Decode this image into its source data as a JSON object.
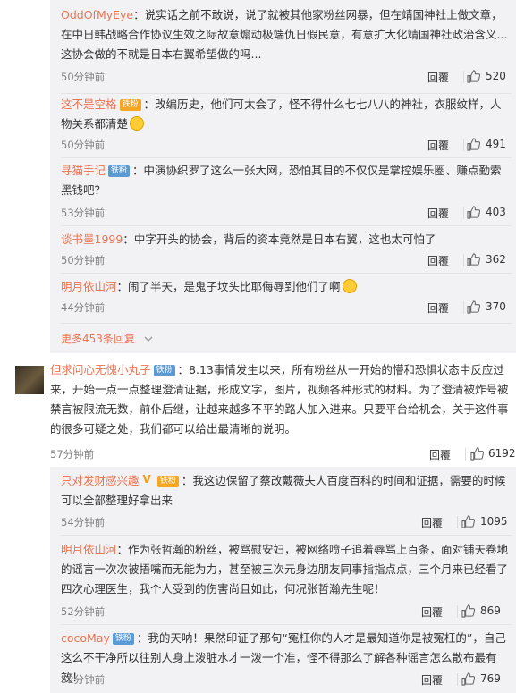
{
  "reply_label": "回覆",
  "thread1": {
    "replies": [
      {
        "user": "OddOfMyEye",
        "badge": null,
        "emoji": false,
        "text": "说实话之前不敢说，说了就被其他家粉丝网暴，但在靖国神社上做文章，在中日韩战略合作协议生效之际故意煽动极端仇日假民意，有意扩大化靖国神社政治含义...这协会做的不就是日本右翼希望做的吗...",
        "time": "50分钟前",
        "likes": "520"
      },
      {
        "user": "这不是空格",
        "badge": "铁粉",
        "emoji": true,
        "text": "改编历史，他们可太会了，怪不得什么七七八八的神社，衣服纹样，人物关系都清楚",
        "time": "50分钟前",
        "likes": "491"
      },
      {
        "user": "寻猫手记",
        "badge": "铁粉",
        "emoji": false,
        "text": "中演协织罗了这么一张大网，恐怕其目的不仅仅是掌控娱乐圈、赚点勤索黑钱吧？",
        "time": "53分钟前",
        "likes": "403"
      },
      {
        "user": "谈书墨1999",
        "badge": null,
        "emoji": false,
        "text": "中字开头的协会，背后的资本竟然是日本右翼，这也太可怕了",
        "time": "50分钟前",
        "likes": "362"
      },
      {
        "user": "明月依山河",
        "badge": null,
        "emoji": true,
        "text": "闹了半天，是鬼子坟头比耶侮辱到他们了啊",
        "time": "44分钟前",
        "likes": "370"
      }
    ],
    "more_label": "更多453条回复"
  },
  "main_comment": {
    "user": "但求问心无愧小丸子",
    "badge": "铁粉",
    "text": "8.13事情发生以来，所有粉丝从一开始的懵和恐惧状态中反应过来，开始一点一点整理澄清证据，形成文字，图片，视频各种形式的材料。为了澄清被炸号被禁言被限流无数，前仆后继，让越来越多不平的路人加入进来。只要平台给机会，关于这件事的很多可疑之处，我们都可以给出最清晰的说明。",
    "time": "57分钟前",
    "likes": "6192"
  },
  "thread2": {
    "replies": [
      {
        "user": "只对发财感兴趣",
        "badge": "铁粉",
        "vip": "V",
        "text": "我这边保留了蔡改戴薇夫人百度百科的时间和证据，需要的时候可以全部整理好拿出来",
        "time": "54分钟前",
        "likes": "1095"
      },
      {
        "user": "明月依山河",
        "badge": null,
        "vip": null,
        "text": "作为张哲瀚的粉丝，被骂慰安妇，被网络喷子追着辱骂上百条，面对铺天卷地的谣言一次次被捂嘴而无能为力，甚至被三次元身边朋友同事指指点点，三个月来已经看了四次心理医生，我个人受到的伤害尚且如此，何况张哲瀚先生呢！",
        "time": "52分钟前",
        "likes": "869"
      },
      {
        "user": "cocoMay",
        "badge": "铁粉",
        "vip": null,
        "text": "我的天呐！果然印证了那句“冤枉你的人才是最知道你是被冤枉的”，自己这么不干净所以往别人身上泼脏水才一泼一个准，怪不得那么了解各种谣言怎么散布最有效！",
        "time": "52分钟前",
        "likes": "769"
      }
    ]
  }
}
